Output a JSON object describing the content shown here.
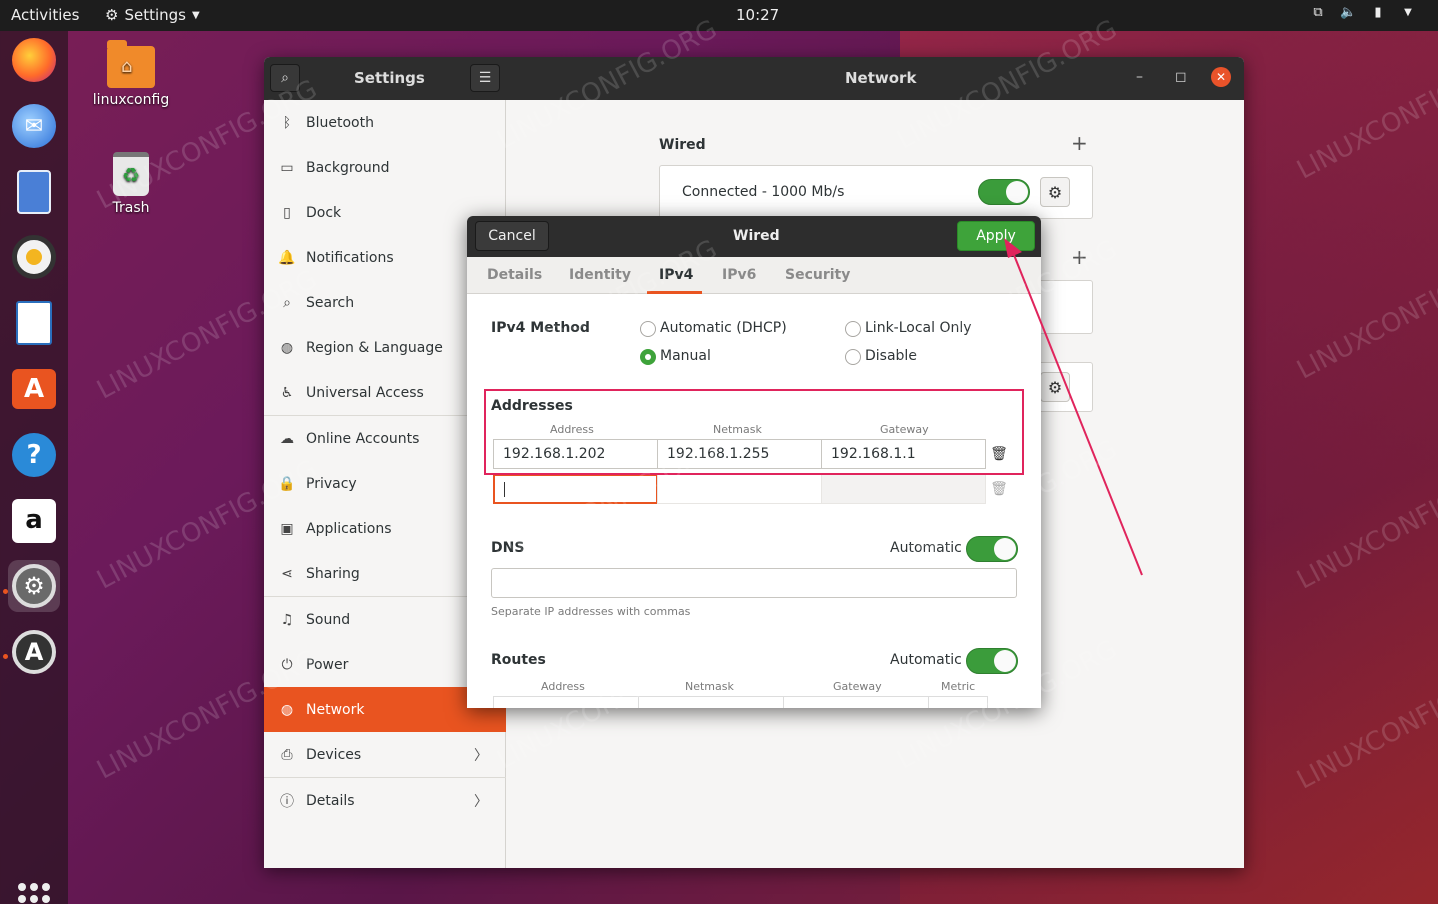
{
  "topbar": {
    "activities": "Activities",
    "app_menu": "Settings",
    "clock": "10:27"
  },
  "desktop": {
    "home_folder": "linuxconfig",
    "trash": "Trash"
  },
  "window": {
    "sidebar_title": "Settings",
    "main_title": "Network"
  },
  "sidebar": {
    "items": [
      {
        "label": "Bluetooth",
        "icon": "bluetooth-icon"
      },
      {
        "label": "Background",
        "icon": "background-icon"
      },
      {
        "label": "Dock",
        "icon": "dock-icon"
      },
      {
        "label": "Notifications",
        "icon": "notifications-icon"
      },
      {
        "label": "Search",
        "icon": "search-icon"
      },
      {
        "label": "Region & Language",
        "icon": "globe-icon"
      },
      {
        "label": "Universal Access",
        "icon": "accessibility-icon"
      },
      {
        "label": "Online Accounts",
        "icon": "cloud-icon"
      },
      {
        "label": "Privacy",
        "icon": "lock-icon"
      },
      {
        "label": "Applications",
        "icon": "applications-icon"
      },
      {
        "label": "Sharing",
        "icon": "share-icon"
      },
      {
        "label": "Sound",
        "icon": "music-icon"
      },
      {
        "label": "Power",
        "icon": "power-icon"
      },
      {
        "label": "Network",
        "icon": "network-icon"
      },
      {
        "label": "Devices",
        "icon": "devices-icon"
      },
      {
        "label": "Details",
        "icon": "info-icon"
      }
    ]
  },
  "network": {
    "wired_title": "Wired",
    "wired_status": "Connected - 1000 Mb/s"
  },
  "dialog": {
    "title": "Wired",
    "cancel": "Cancel",
    "apply": "Apply",
    "tabs": [
      "Details",
      "Identity",
      "IPv4",
      "IPv6",
      "Security"
    ],
    "ipv4_method_label": "IPv4 Method",
    "methods": {
      "dhcp": "Automatic (DHCP)",
      "link_local": "Link-Local Only",
      "manual": "Manual",
      "disable": "Disable"
    },
    "addresses": {
      "title": "Addresses",
      "col_address": "Address",
      "col_netmask": "Netmask",
      "col_gateway": "Gateway",
      "row": {
        "address": "192.168.1.202",
        "netmask": "192.168.1.255",
        "gateway": "192.168.1.1"
      }
    },
    "dns": {
      "title": "DNS",
      "automatic": "Automatic",
      "hint": "Separate IP addresses with commas",
      "value": ""
    },
    "routes": {
      "title": "Routes",
      "automatic": "Automatic",
      "col_address": "Address",
      "col_netmask": "Netmask",
      "col_gateway": "Gateway",
      "col_metric": "Metric"
    }
  },
  "watermark": "LINUXCONFIG.ORG",
  "colors": {
    "accent": "#e95420",
    "switch_on": "#3b9c3b",
    "apply": "#3ea33a",
    "highlight": "#e0245c"
  }
}
